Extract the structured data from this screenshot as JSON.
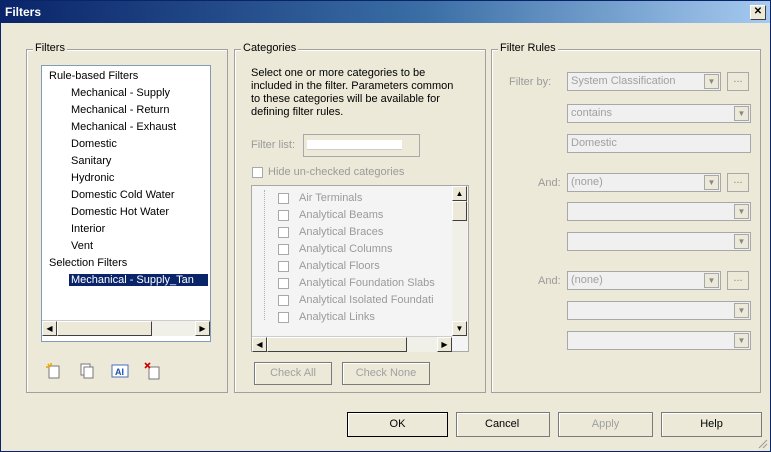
{
  "window": {
    "title": "Filters",
    "close_glyph": "✕"
  },
  "filters_group": {
    "legend": "Filters",
    "tree": [
      "Rule-based Filters",
      "Mechanical - Supply",
      "Mechanical - Return",
      "Mechanical - Exhaust",
      "Domestic",
      "Sanitary",
      "Hydronic",
      "Domestic Cold Water",
      "Domestic Hot Water",
      "Interior",
      "Vent",
      "Selection Filters",
      "Mechanical - Supply_Tan"
    ],
    "toolbar_icons": [
      "new-filter-icon",
      "duplicate-filter-icon",
      "rename-filter-icon",
      "delete-filter-icon"
    ]
  },
  "categories_group": {
    "legend": "Categories",
    "description": "Select one or more categories to be included in the filter.  Parameters common to these categories will be available for defining filter rules.",
    "filter_list_label": "Filter list:",
    "hide_unchecked_label": "Hide un-checked categories",
    "items": [
      "Air Terminals",
      "Analytical Beams",
      "Analytical Braces",
      "Analytical Columns",
      "Analytical Floors",
      "Analytical Foundation Slabs",
      "Analytical Isolated Foundati",
      "Analytical Links"
    ],
    "check_all": "Check All",
    "check_none": "Check None"
  },
  "rules_group": {
    "legend": "Filter Rules",
    "filter_by_label": "Filter by:",
    "filter_by_value": "System Classification",
    "operator": "contains",
    "value": "Domestic",
    "and1_label": "And:",
    "and1_value": "(none)",
    "and2_label": "And:",
    "and2_value": "(none)",
    "dots": "..."
  },
  "footer": {
    "ok": "OK",
    "cancel": "Cancel",
    "apply": "Apply",
    "help": "Help"
  }
}
